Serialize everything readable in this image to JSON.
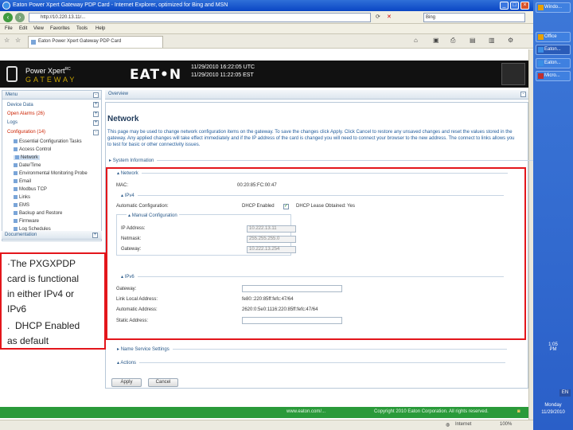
{
  "browser": {
    "title": "Eaton Power Xpert Gateway PDP Card - Internet Explorer, optimized for Bing and MSN",
    "address": "http://10.220.13.11/...",
    "search_placeholder": "Bing",
    "menu": [
      "File",
      "Edit",
      "View",
      "Favorites",
      "Tools",
      "Help"
    ],
    "tab_label": "Eaton Power Xpert Gateway PDP Card"
  },
  "header": {
    "product": "Power Xpert",
    "product_sup": "RC",
    "product_sub": "GATEWAY",
    "brand": "EAT•N",
    "clock_utc": "11/29/2010 16:22:05 UTC",
    "clock_local": "11/29/2010 11:22:05 EST"
  },
  "nav": {
    "menu_title": "Menu",
    "items": [
      {
        "label": "Device Data"
      },
      {
        "label": "Open Alarms (26)"
      },
      {
        "label": "Logs"
      },
      {
        "label": "Configuration (14)"
      }
    ],
    "tree": [
      "Essential Configuration Tasks",
      "Access Control",
      "Network",
      "Date/Time",
      "Environmental Monitoring Probe",
      "Email",
      "Modbus TCP",
      "Links",
      "EMS",
      "Backup and Restore",
      "Firmware",
      "Log Schedules"
    ],
    "documentation": "Documentation"
  },
  "content": {
    "overview": "Overview",
    "title": "Network",
    "description": "This page may be used to change network configuration items on the gateway. To save the changes click Apply. Click Cancel to restore any unsaved changes and reset the values stored in the gateway. Any applied changes will take effect immediately and if the IP address of the card is changed you will need to connect your browser to the new address. The connect to links allows you to test for basic or other connectivity issues.",
    "system_information": "System Information",
    "network_section": "Network",
    "mac_label": "MAC:",
    "mac_value": "00:20:85:FC:00:47",
    "ipv4_section": "IPv4",
    "auto_config_label": "Automatic Configuration:",
    "dhcp_enabled": "DHCP Enabled",
    "dhcp_lease": "DHCP Lease Obtained: Yes",
    "manual_config": "Manual Configuration",
    "ip_label": "IP Address:",
    "ip_value": "10.222.13.11",
    "netmask_label": "Netmask:",
    "netmask_value": "255.255.255.0",
    "gateway_label": "Gateway:",
    "gateway_value": "10.222.13.254",
    "ipv6_section": "IPv6",
    "v6_gateway_label": "Gateway:",
    "link_local_label": "Link Local Address:",
    "link_local_value": "fe80::220:85ff:fefc:47/64",
    "auto_addr_label": "Automatic Address:",
    "auto_addr_value": "2620:0:5e0:1116:220:85ff:fefc:47/64",
    "static_addr_label": "Static Address:",
    "name_service": "Name Service Settings",
    "actions": "Actions",
    "apply": "Apply",
    "cancel": "Cancel"
  },
  "callout": {
    "lines": [
      "The PXGXPDP",
      "card is functional",
      "in either IPv4 or",
      "IPv6",
      "DHCP Enabled",
      "as default"
    ]
  },
  "footer": {
    "left": "www.eaton.com/...",
    "right": "Copyright 2010 Eaton Corporation. All rights reserved."
  },
  "status": {
    "zone": "Internet",
    "zoom": "100%"
  },
  "desktop": {
    "tasks": [
      "Windo...",
      "Office",
      "Eaton...",
      "Eaton...",
      "Micro..."
    ],
    "clock_lines": [
      "1:05",
      "PM"
    ],
    "lang": "EN",
    "day": "Monday",
    "date": "11/29/2010"
  },
  "colors": {
    "highlight": "#e3161b",
    "footer": "#2a9a3a",
    "header": "#111111"
  }
}
